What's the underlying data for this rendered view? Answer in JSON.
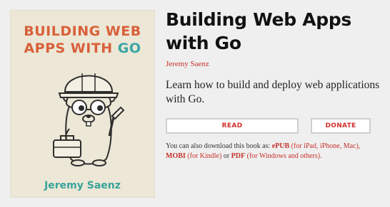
{
  "book": {
    "title": "Building Web Apps with Go",
    "author": "Jeremy Saenz",
    "description": "Learn how to build and deploy web applications with Go."
  },
  "cover": {
    "title_line1": "BUILDING WEB",
    "title_line2_a": "APPS WITH ",
    "title_line2_b": "GO",
    "author": "Jeremy Saenz",
    "illustration_icon": "gopher-construction-icon"
  },
  "actions": {
    "read_label": "READ",
    "donate_label": "DONATE"
  },
  "download": {
    "intro": "You can also download this book as: ",
    "epub_label": "ePUB",
    "epub_note": " (for iPad, iPhone, Mac),",
    "mobi_label": "MOBI",
    "mobi_note": " (for Kindle)",
    "or_text": " or ",
    "pdf_label": "PDF",
    "pdf_note": " (for Windows and others)."
  },
  "colors": {
    "accent": "#c7312a",
    "cover_orange": "#d8603a",
    "cover_teal": "#3aa6a6",
    "background": "#efefef"
  }
}
